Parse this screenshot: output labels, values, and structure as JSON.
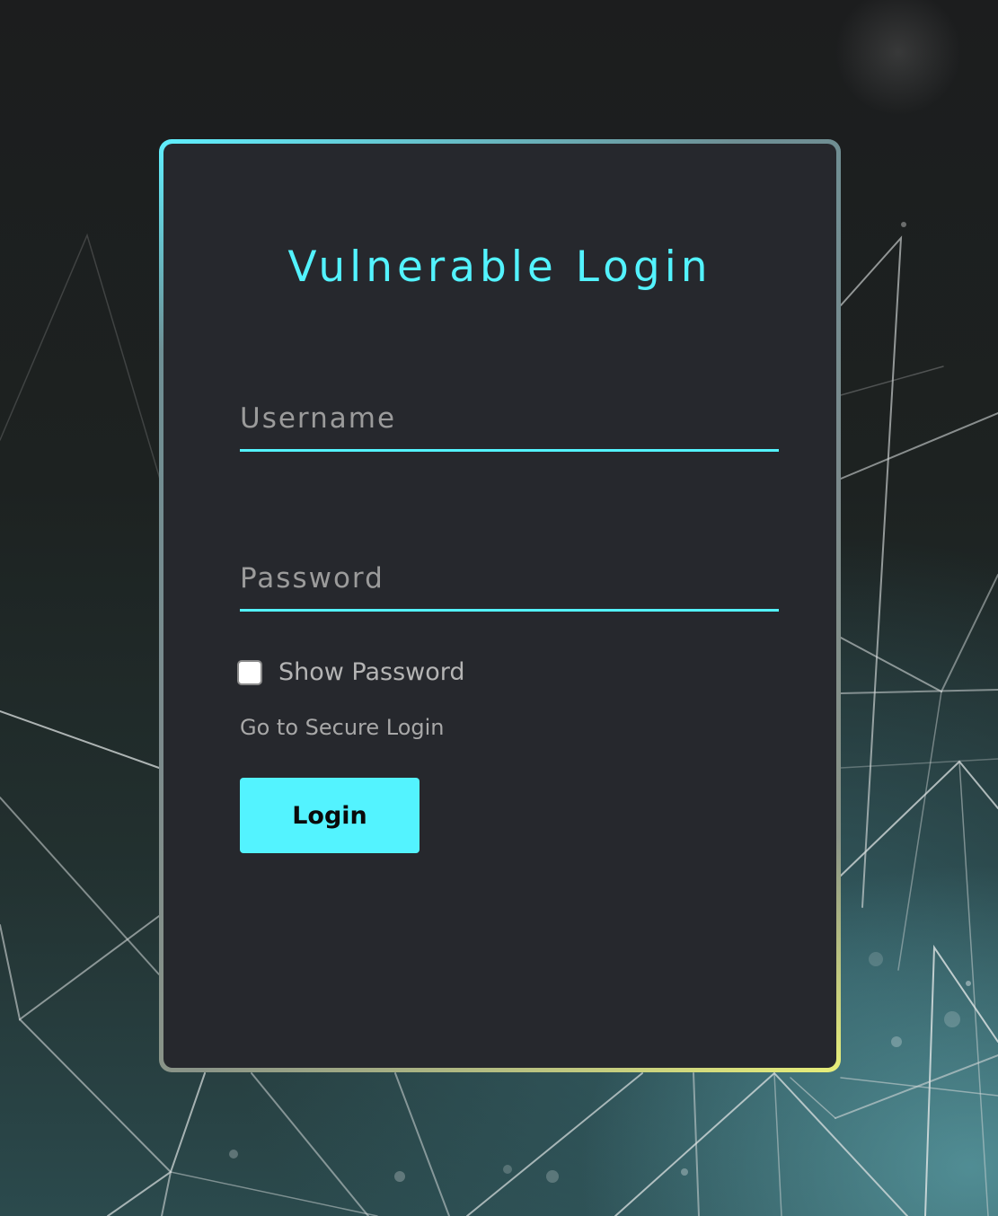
{
  "page": {
    "title": "Vulnerable Login"
  },
  "form": {
    "username": {
      "value": "",
      "placeholder": "Username"
    },
    "password": {
      "value": "",
      "placeholder": "Password"
    },
    "show_password": {
      "label": "Show Password",
      "checked": false
    },
    "secure_link_label": "Go to Secure Login",
    "login_button_label": "Login"
  },
  "colors": {
    "accent": "#53f3ff",
    "card_background": "#26282d",
    "muted_text": "#a8a8a8"
  }
}
